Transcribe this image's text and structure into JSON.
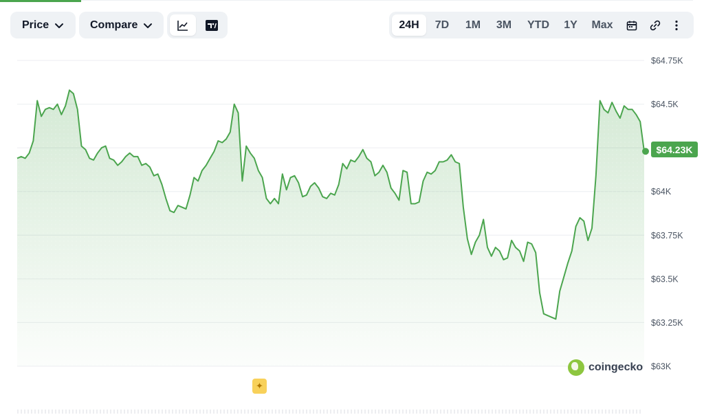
{
  "toolbar": {
    "price_label": "Price",
    "compare_label": "Compare",
    "chart_types": [
      "line-chart-icon",
      "tradingview-icon"
    ],
    "active_chart_type": "line-chart-icon",
    "ranges": [
      "24H",
      "7D",
      "1M",
      "3M",
      "YTD",
      "1Y",
      "Max"
    ],
    "active_range": "24H",
    "tools": [
      "calendar-icon",
      "link-icon",
      "more-vertical-icon"
    ]
  },
  "current_price_label": "$64.23K",
  "brand": "coingecko",
  "colors": {
    "accent": "#4ba54e",
    "line": "#4ba54e",
    "area_top": "#d5ecd5"
  },
  "chart_data": {
    "type": "area",
    "ylim": [
      63000,
      64750
    ],
    "yticks": [
      64750,
      64500,
      64250,
      64000,
      63750,
      63500,
      63250,
      63000
    ],
    "ytick_labels": [
      "$64.75K",
      "$64.5K",
      "",
      "$64K",
      "$63.75K",
      "$63.5K",
      "$63.25K",
      "$63K"
    ],
    "grid": true,
    "legend": "none",
    "series": [
      {
        "values": [
          64190,
          64200,
          64190,
          64220,
          64290,
          64520,
          64430,
          64470,
          64480,
          64470,
          64500,
          64440,
          64490,
          64580,
          64560,
          64470,
          64260,
          64240,
          64190,
          64180,
          64220,
          64250,
          64260,
          64190,
          64180,
          64150,
          64170,
          64200,
          64220,
          64200,
          64200,
          64150,
          64160,
          64140,
          64090,
          64100,
          64040,
          63960,
          63890,
          63880,
          63920,
          63910,
          63900,
          63980,
          64080,
          64060,
          64120,
          64150,
          64190,
          64230,
          64290,
          64280,
          64300,
          64340,
          64500,
          64450,
          64060,
          64260,
          64220,
          64190,
          64120,
          64080,
          63960,
          63930,
          63960,
          63930,
          64100,
          64010,
          64080,
          64090,
          64050,
          63970,
          63980,
          64030,
          64050,
          64020,
          63970,
          63960,
          63990,
          63980,
          64040,
          64160,
          64130,
          64180,
          64170,
          64200,
          64240,
          64190,
          64170,
          64090,
          64110,
          64150,
          64110,
          64020,
          63990,
          63950,
          64120,
          64110,
          63930,
          63930,
          63940,
          64060,
          64110,
          64100,
          64120,
          64170,
          64170,
          64180,
          64210,
          64170,
          64160,
          63910,
          63730,
          63640,
          63710,
          63750,
          63840,
          63680,
          63630,
          63680,
          63660,
          63610,
          63620,
          63720,
          63680,
          63660,
          63600,
          63710,
          63700,
          63650,
          63420,
          63300,
          63290,
          63280,
          63270,
          63430,
          63510,
          63590,
          63660,
          63800,
          63850,
          63830,
          63720,
          63790,
          64090,
          64520,
          64470,
          64450,
          64510,
          64460,
          64420,
          64490,
          64470,
          64470,
          64440,
          64400,
          64230
        ]
      }
    ]
  }
}
